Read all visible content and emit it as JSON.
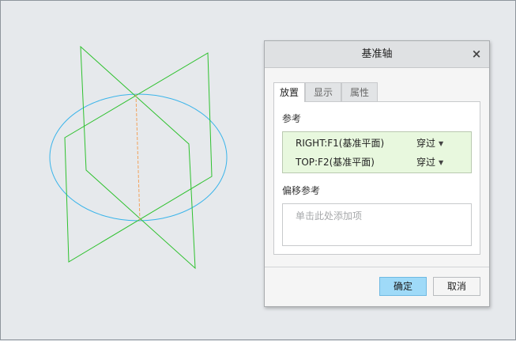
{
  "colors": {
    "background": "#e6e9ec",
    "plane_edges": "#2ec12e",
    "axis_line": "#f2a25c",
    "circle": "#3ab4ea",
    "reference_highlight": "#e8f8de",
    "ok_button": "#9fdaf8"
  },
  "viewport": {
    "plane_1_icon": "datum-plane-icon",
    "plane_2_icon": "datum-plane-icon",
    "axis_icon": "datum-axis-icon",
    "circle_icon": "reference-circle-icon"
  },
  "dialog": {
    "title": "基准轴",
    "close_symbol": "×",
    "tabs": [
      {
        "label": "放置",
        "active": true
      },
      {
        "label": "显示",
        "active": false
      },
      {
        "label": "属性",
        "active": false
      }
    ],
    "references_label": "参考",
    "references": [
      {
        "name": "RIGHT:F1(基准平面)",
        "type": "穿过"
      },
      {
        "name": "TOP:F2(基准平面)",
        "type": "穿过"
      }
    ],
    "offset_label": "偏移参考",
    "offset_placeholder": "单击此处添加项",
    "ok_label": "确定",
    "cancel_label": "取消"
  }
}
